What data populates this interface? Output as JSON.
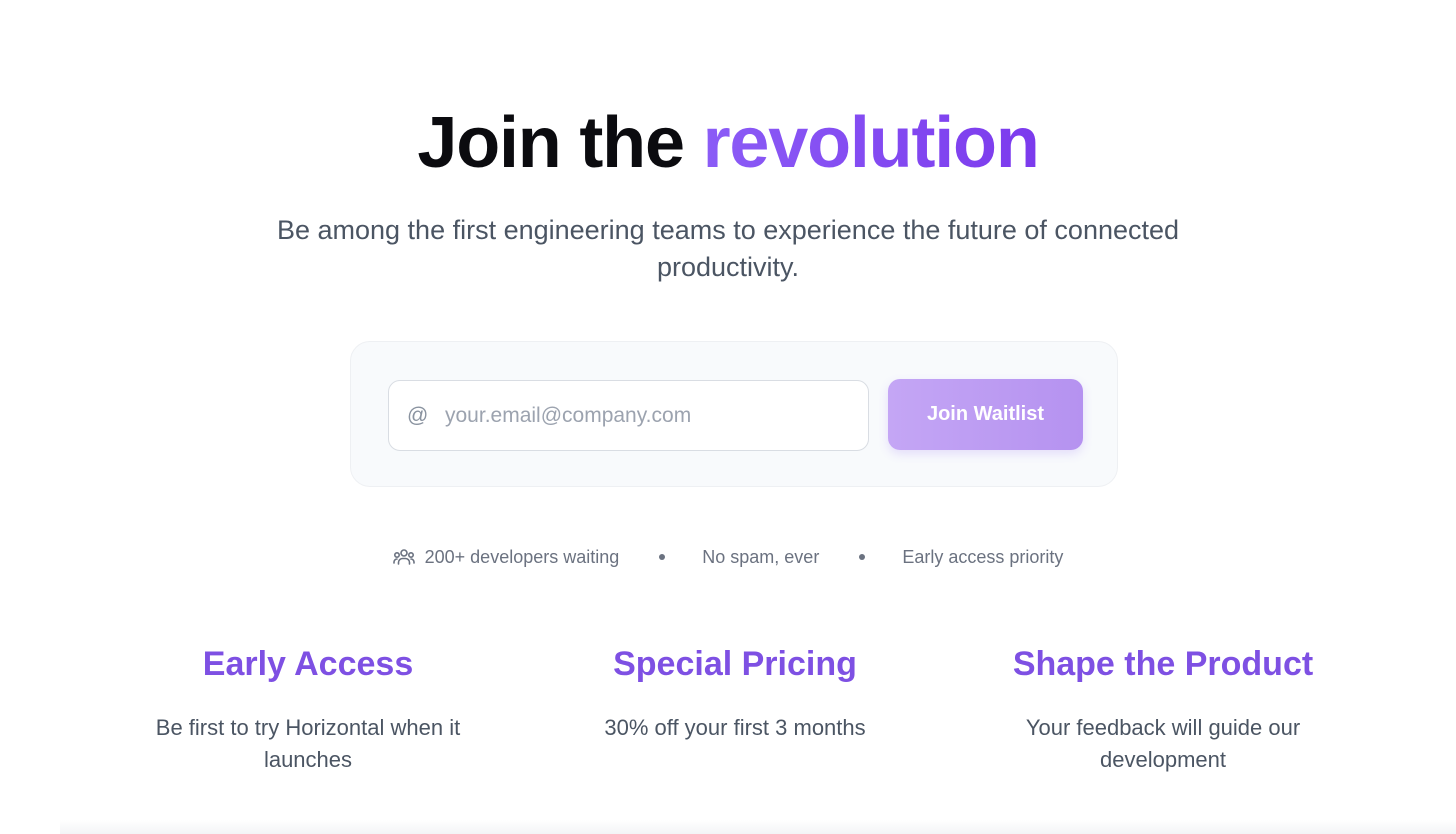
{
  "hero": {
    "title_prefix": "Join the ",
    "title_accent": "revolution",
    "subtitle": "Be among the first engineering teams to experience the future of connected productivity."
  },
  "signup": {
    "email_placeholder": "your.email@company.com",
    "email_value": "",
    "at_icon": "@",
    "button_label": "Join Waitlist"
  },
  "meta": {
    "developers_waiting": "200+ developers waiting",
    "no_spam": "No spam, ever",
    "early_priority": "Early access priority"
  },
  "features": [
    {
      "title": "Early Access",
      "description": "Be first to try Horizontal when it launches"
    },
    {
      "title": "Special Pricing",
      "description": "30% off your first 3 months"
    },
    {
      "title": "Shape the Product",
      "description": "Your feedback will guide our development"
    }
  ],
  "colors": {
    "accent": "#7c3aed",
    "button": "#b592f0",
    "text_muted": "#4b5563"
  }
}
